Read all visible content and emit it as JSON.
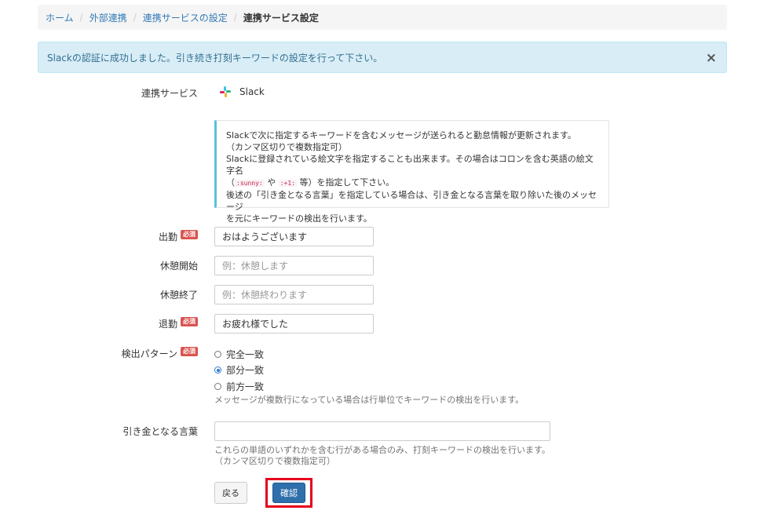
{
  "breadcrumb": {
    "items": [
      "ホーム",
      "外部連携",
      "連携サービスの設定"
    ],
    "current": "連携サービス設定",
    "separator": "/"
  },
  "alert": {
    "message": "Slackの認証に成功しました。引き続き打刻キーワードの設定を行って下さい。",
    "close": "×"
  },
  "service": {
    "label": "連携サービス",
    "name": "Slack",
    "icon": "slack-icon"
  },
  "info": {
    "line1": "Slackで次に指定するキーワードを含むメッセージが送られると勤怠情報が更新されます。",
    "line2": "（カンマ区切りで複数指定可）",
    "line3": "Slackに登録されている絵文字を指定することも出来ます。その場合はコロンを含む英語の絵文字名",
    "line4_open": "（",
    "emoji1": ":sunny:",
    "line4_mid": " や ",
    "emoji2": ":+1:",
    "line4_close": " 等）を指定して下さい。",
    "line5": "後述の「引き金となる言葉」を指定している場合は、引き金となる言葉を取り除いた後のメッセージ",
    "line6": "を元にキーワードの検出を行います。"
  },
  "required_badge": "必須",
  "fields": {
    "clock_in": {
      "label": "出勤",
      "value": "おはようございます",
      "placeholder": ""
    },
    "break_start": {
      "label": "休憩開始",
      "value": "",
      "placeholder": "例：休憩します"
    },
    "break_end": {
      "label": "休憩終了",
      "value": "",
      "placeholder": "例：休憩終わります"
    },
    "clock_out": {
      "label": "退勤",
      "value": "お疲れ様でした",
      "placeholder": ""
    }
  },
  "detection": {
    "label": "検出パターン",
    "options": [
      "完全一致",
      "部分一致",
      "前方一致"
    ],
    "selected": "部分一致",
    "help": "メッセージが複数行になっている場合は行単位でキーワードの検出を行います。"
  },
  "trigger": {
    "label": "引き金となる言葉",
    "value": "",
    "help1": "これらの単語のいずれかを含む行がある場合のみ、打刻キーワードの検出を行います。",
    "help2": "（カンマ区切りで複数指定可）"
  },
  "buttons": {
    "back": "戻る",
    "confirm": "確認"
  },
  "colors": {
    "link": "#337ab7",
    "alert_bg": "#d9edf7",
    "required": "#d9534f",
    "primary": "#2f6fab",
    "highlight": "#e5001a"
  }
}
